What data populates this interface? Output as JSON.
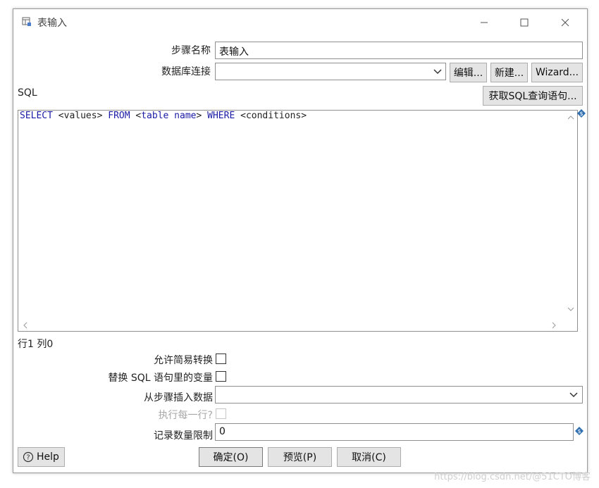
{
  "window": {
    "title": "表输入",
    "controls": {
      "minimize": "—",
      "maximize": "☐",
      "close": "✕"
    }
  },
  "step_name": {
    "label": "步骤名称",
    "value": "表输入"
  },
  "db_connection": {
    "label": "数据库连接",
    "value": "",
    "buttons": {
      "edit": "编辑...",
      "new": "新建...",
      "wizard": "Wizard..."
    }
  },
  "sql": {
    "label": "SQL",
    "get_query_button": "获取SQL查询语句...",
    "tokens": [
      {
        "text": "SELECT",
        "kind": "keyword"
      },
      {
        "text": " <values> ",
        "kind": "text"
      },
      {
        "text": "FROM",
        "kind": "keyword"
      },
      {
        "text": " <",
        "kind": "text"
      },
      {
        "text": "table name",
        "kind": "keyword"
      },
      {
        "text": "> ",
        "kind": "text"
      },
      {
        "text": "WHERE",
        "kind": "keyword"
      },
      {
        "text": " <conditions>",
        "kind": "text"
      }
    ]
  },
  "cursor_position": "行1 列0",
  "options": {
    "lazy_conversion": {
      "label": "允许简易转换",
      "checked": false
    },
    "replace_variables": {
      "label": "替换 SQL 语句里的变量",
      "checked": false
    },
    "insert_from_step": {
      "label": "从步骤插入数据",
      "value": ""
    },
    "execute_each_row": {
      "label": "执行每一行?",
      "checked": false,
      "enabled": false
    },
    "limit": {
      "label": "记录数量限制",
      "value": "0"
    }
  },
  "footer": {
    "help": "Help",
    "ok": "确定(O)",
    "preview": "预览(P)",
    "cancel": "取消(C)"
  },
  "watermark": "https://blog.csdn.net/@51CTO博客",
  "colors": {
    "keyword": "#1a1aa6",
    "button_bg": "#e4e4e4",
    "border": "#8f8f8f",
    "disabled_text": "#a8a8a8"
  }
}
